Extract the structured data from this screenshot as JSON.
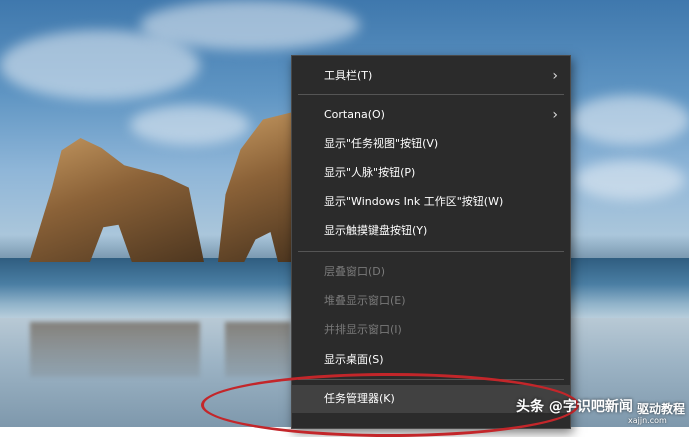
{
  "context_menu": {
    "items": [
      {
        "label": "工具栏(T)",
        "submenu": true,
        "enabled": true
      },
      {
        "label": "Cortana(O)",
        "submenu": true,
        "enabled": true
      },
      {
        "label": "显示\"任务视图\"按钮(V)",
        "enabled": true
      },
      {
        "label": "显示\"人脉\"按钮(P)",
        "enabled": true
      },
      {
        "label": "显示\"Windows Ink 工作区\"按钮(W)",
        "enabled": true
      },
      {
        "label": "显示触摸键盘按钮(Y)",
        "enabled": true
      },
      {
        "label": "层叠窗口(D)",
        "enabled": false
      },
      {
        "label": "堆叠显示窗口(E)",
        "enabled": false
      },
      {
        "label": "并排显示窗口(I)",
        "enabled": false
      },
      {
        "label": "显示桌面(S)",
        "enabled": true
      },
      {
        "label": "任务管理器(K)",
        "enabled": true,
        "highlighted": true
      }
    ],
    "colors": {
      "background": "#2b2b2b",
      "text": "#ffffff",
      "disabled_text": "#7a7a7a",
      "annotation": "#c3262a"
    }
  },
  "watermark": {
    "text": "头条 @字识吧新闻",
    "site": "驱动教程",
    "url": "xajjn.com"
  }
}
